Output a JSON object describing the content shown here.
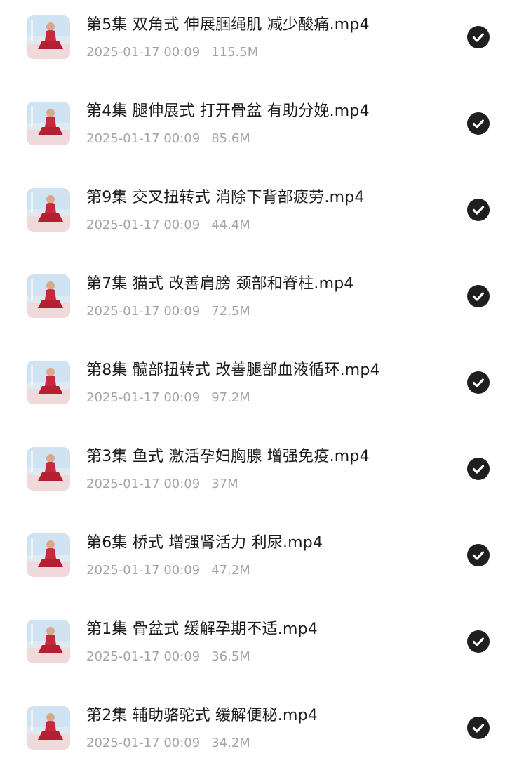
{
  "files": [
    {
      "name": "第5集 双角式 伸展腘绳肌 减少酸痛.mp4",
      "date": "2025-01-17 00:09",
      "size": "115.5M",
      "selected": true,
      "thumb": "yoga-video-thumbnail"
    },
    {
      "name": "第4集 腿伸展式 打开骨盆 有助分娩.mp4",
      "date": "2025-01-17 00:09",
      "size": "85.6M",
      "selected": true,
      "thumb": "yoga-video-thumbnail"
    },
    {
      "name": "第9集 交叉扭转式 消除下背部疲劳.mp4",
      "date": "2025-01-17 00:09",
      "size": "44.4M",
      "selected": true,
      "thumb": "yoga-video-thumbnail"
    },
    {
      "name": "第7集 猫式 改善肩膀 颈部和脊柱.mp4",
      "date": "2025-01-17 00:09",
      "size": "72.5M",
      "selected": true,
      "thumb": "yoga-video-thumbnail"
    },
    {
      "name": "第8集 髋部扭转式 改善腿部血液循环.mp4",
      "date": "2025-01-17 00:09",
      "size": "97.2M",
      "selected": true,
      "thumb": "yoga-video-thumbnail"
    },
    {
      "name": "第3集 鱼式 激活孕妇胸腺 增强免疫.mp4",
      "date": "2025-01-17 00:09",
      "size": "37M",
      "selected": true,
      "thumb": "yoga-video-thumbnail"
    },
    {
      "name": "第6集 桥式 增强肾活力 利尿.mp4",
      "date": "2025-01-17 00:09",
      "size": "47.2M",
      "selected": true,
      "thumb": "yoga-video-thumbnail"
    },
    {
      "name": "第1集 骨盆式 缓解孕期不适.mp4",
      "date": "2025-01-17 00:09",
      "size": "36.5M",
      "selected": true,
      "thumb": "yoga-video-thumbnail"
    },
    {
      "name": "第2集 辅助骆驼式 缓解便秘.mp4",
      "date": "2025-01-17 00:09",
      "size": "34.2M",
      "selected": true,
      "thumb": "yoga-video-thumbnail"
    }
  ],
  "colors": {
    "title": "#1b1b1b",
    "meta": "#a4a4a4",
    "check_bg": "#1f1f1f",
    "outfit": "#c8283a"
  },
  "icons": {
    "selected": "check-circle-icon"
  }
}
